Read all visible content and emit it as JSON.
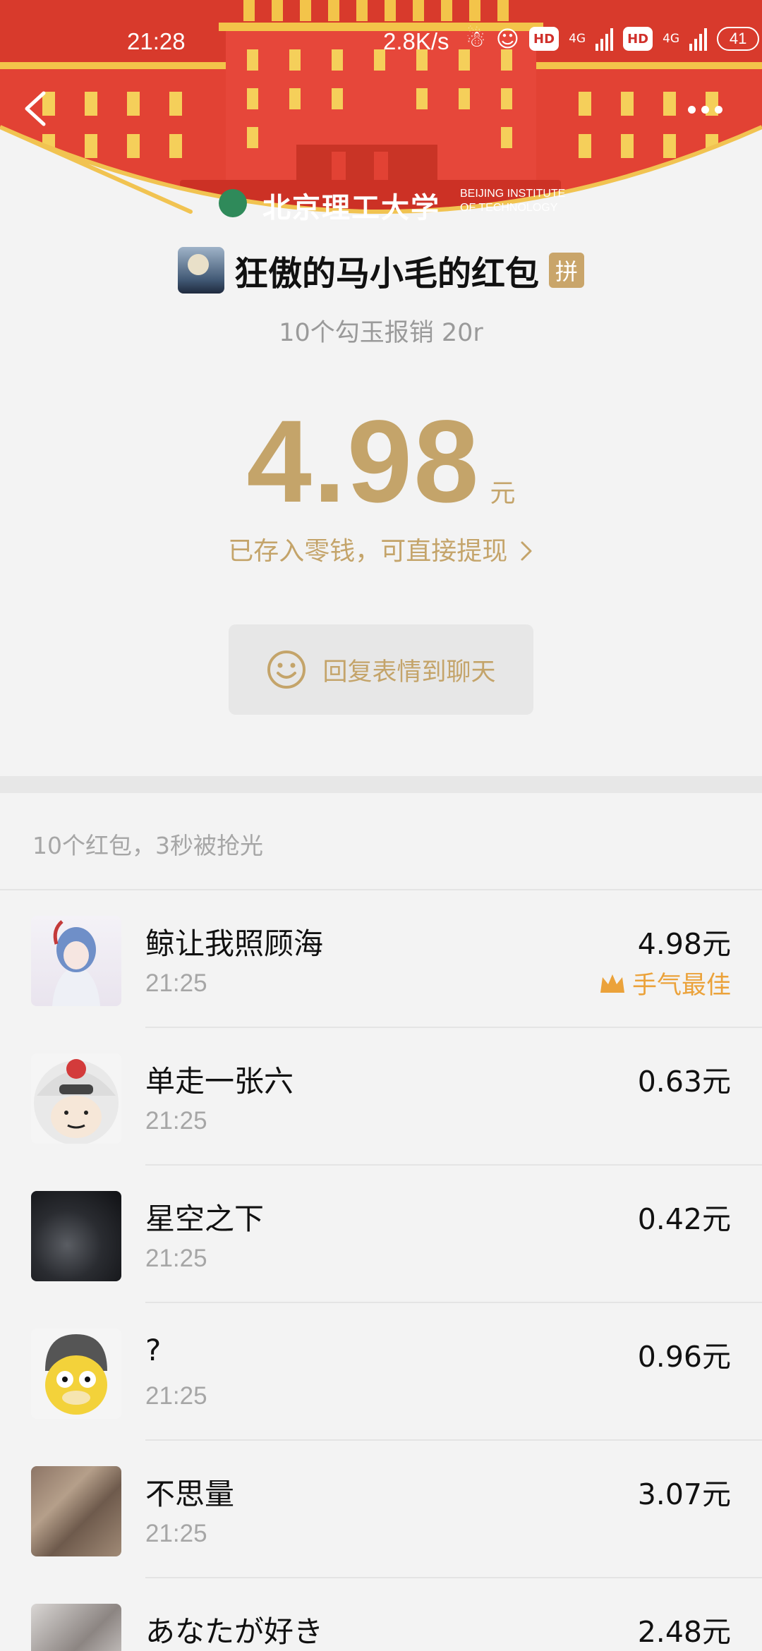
{
  "status_bar": {
    "time": "21:28",
    "net_speed": "2.8K/s",
    "hd1": "HD",
    "net1": "4G",
    "hd2": "HD",
    "net2": "4G",
    "battery": "41"
  },
  "banner": {
    "school_cn": "北京理工大学",
    "school_en_line1": "BEIJING INSTITUTE",
    "school_en_line2": "OF TECHNOLOGY"
  },
  "packet": {
    "sender_name": "狂傲的马小毛的红包",
    "pin_badge": "拼",
    "message": "10个勾玉报销 20r",
    "amount": "4.98",
    "amount_unit": "元",
    "stored_text": "已存入零钱，可直接提现",
    "reply_label": "回复表情到聊天"
  },
  "summary": "10个红包，3秒被抢光",
  "colors": {
    "gold": "#c4a46a",
    "banner_red": "#d83a2c",
    "best_orange": "#eba23a"
  },
  "receivers": [
    {
      "name": "鲸让我照顾海",
      "time": "21:25",
      "amount": "4.98元",
      "best": "手气最佳"
    },
    {
      "name": "单走一张六",
      "time": "21:25",
      "amount": "0.63元"
    },
    {
      "name": "星空之下",
      "time": "21:25",
      "amount": "0.42元"
    },
    {
      "name": "?",
      "time": "21:25",
      "amount": "0.96元"
    },
    {
      "name": "不思量",
      "time": "21:25",
      "amount": "3.07元"
    },
    {
      "name": "あなたが好き",
      "time": "",
      "amount": "2.48元"
    }
  ]
}
